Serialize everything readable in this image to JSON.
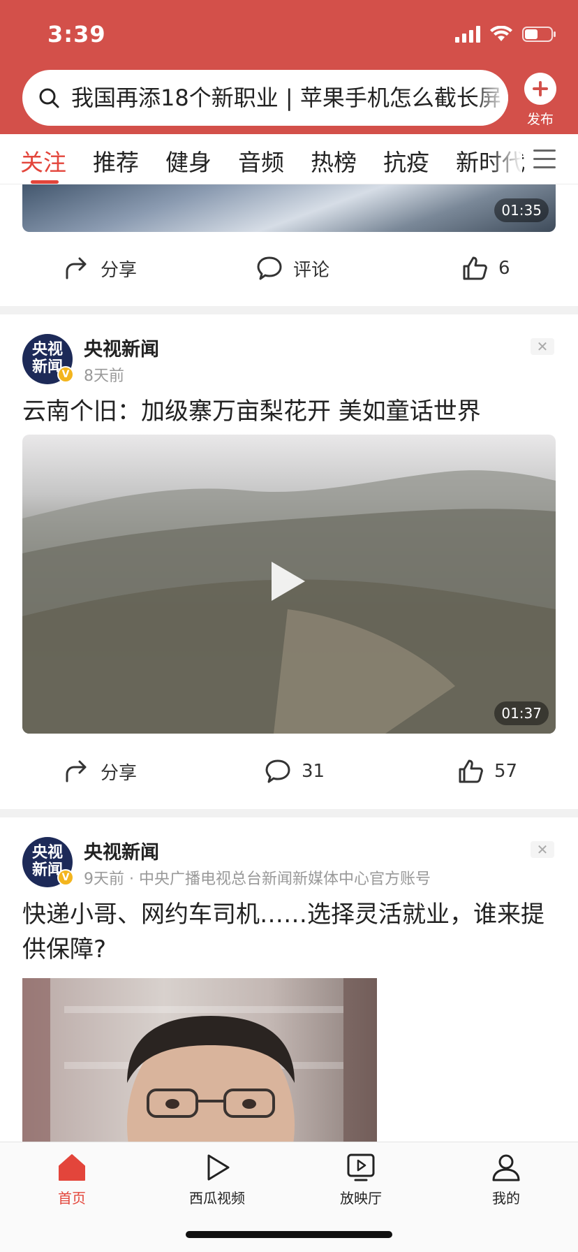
{
  "status_bar": {
    "time": "3:39"
  },
  "search": {
    "text": "我国再添18个新职业 | 苹果手机怎么截长屏"
  },
  "publish": {
    "label": "发布"
  },
  "tabs": [
    {
      "label": "关注",
      "active": true
    },
    {
      "label": "推荐"
    },
    {
      "label": "健身"
    },
    {
      "label": "音频"
    },
    {
      "label": "热榜"
    },
    {
      "label": "抗疫"
    },
    {
      "label": "新时代"
    }
  ],
  "feed": {
    "partial_item": {
      "duration": "01:35",
      "share_label": "分享",
      "comment_label": "评论",
      "like_count": "6"
    },
    "post1": {
      "avatar_text": "央视新闻",
      "author": "央视新闻",
      "meta": "8天前",
      "title": "云南个旧：加级寨万亩梨花开 美如童话世界",
      "duration": "01:37",
      "share_label": "分享",
      "comment_count": "31",
      "like_count": "57"
    },
    "post2": {
      "avatar_text": "央视新闻",
      "author": "央视新闻",
      "meta": "9天前 · 中央广播电视总台新闻新媒体中心官方账号",
      "title": "快递小哥、网约车司机……选择灵活就业，谁来提供保障?"
    }
  },
  "bottom_nav": [
    {
      "label": "首页",
      "icon": "home-icon",
      "active": true
    },
    {
      "label": "西瓜视频",
      "icon": "play-triangle-icon"
    },
    {
      "label": "放映厅",
      "icon": "tv-screen-icon"
    },
    {
      "label": "我的",
      "icon": "person-icon"
    }
  ],
  "colors": {
    "brand_red": "#d3504a",
    "accent_red": "#e3453b"
  }
}
